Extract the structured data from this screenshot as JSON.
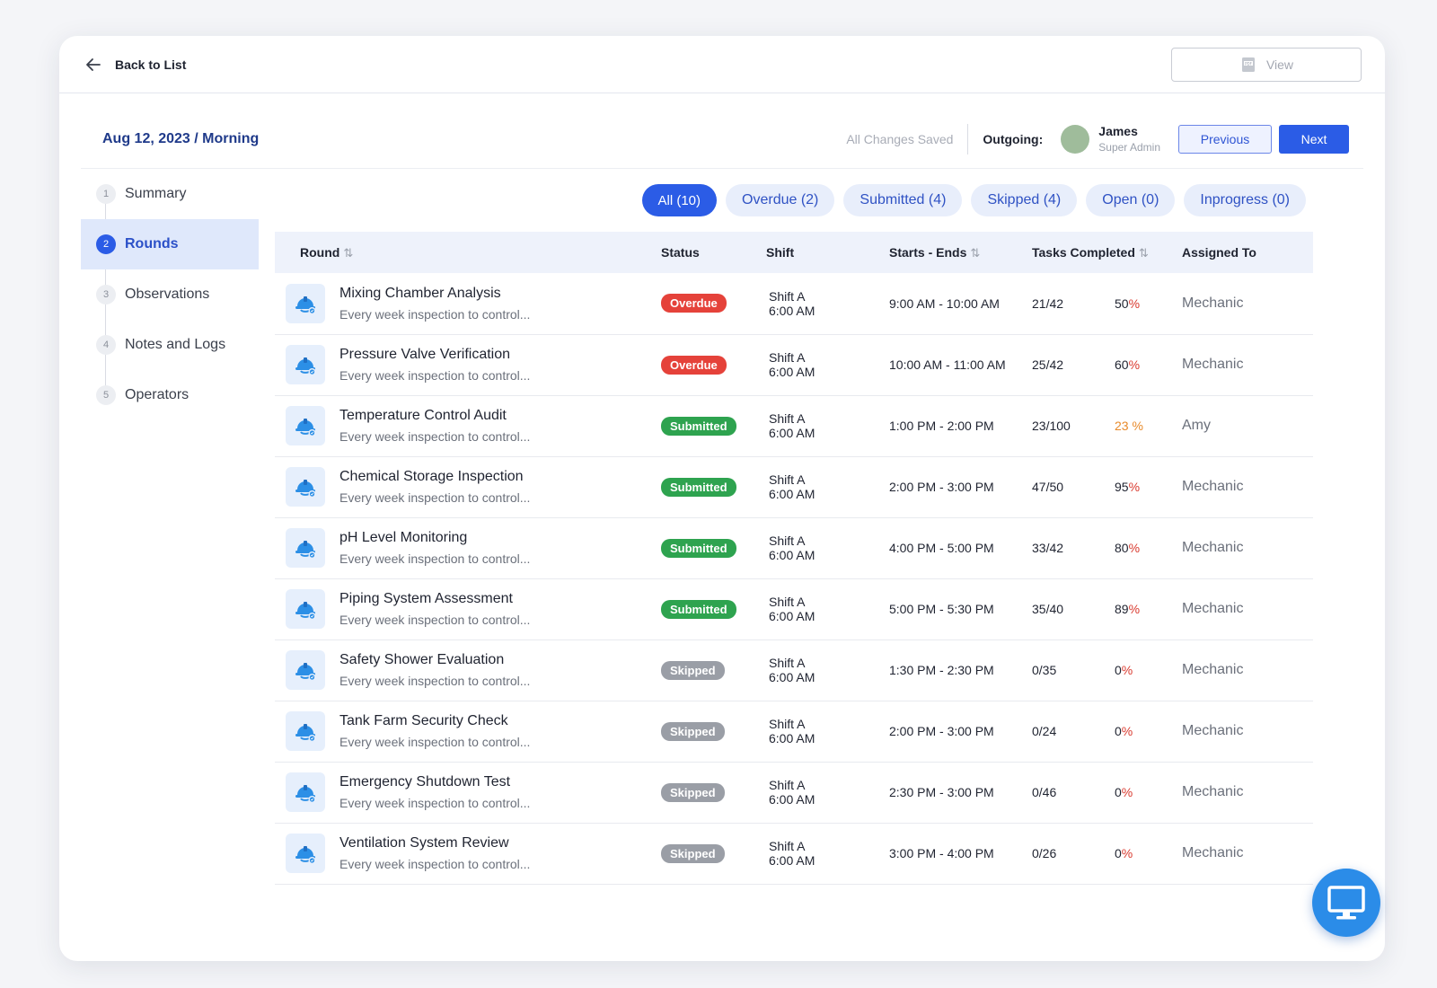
{
  "topbar": {
    "back_label": "Back to List",
    "view_label": "View"
  },
  "header": {
    "title": "Aug 12, 2023 / Morning",
    "save_status": "All Changes Saved",
    "outgoing_label": "Outgoing:",
    "user_name": "James",
    "user_role": "Super Admin",
    "prev_label": "Previous",
    "next_label": "Next"
  },
  "sidebar": {
    "steps": [
      {
        "num": "1",
        "label": "Summary"
      },
      {
        "num": "2",
        "label": "Rounds"
      },
      {
        "num": "3",
        "label": "Observations"
      },
      {
        "num": "4",
        "label": "Notes and Logs"
      },
      {
        "num": "5",
        "label": "Operators"
      }
    ],
    "active": "Rounds"
  },
  "filters": [
    "All (10)",
    "Overdue (2)",
    "Submitted (4)",
    "Skipped (4)",
    "Open (0)",
    "Inprogress (0)"
  ],
  "table": {
    "columns": [
      "Round",
      "Status",
      "Shift",
      "Starts - Ends",
      "Tasks Completed",
      "Assigned To"
    ],
    "rows": [
      {
        "name": "Mixing Chamber Analysis",
        "desc": "Every week inspection to control...",
        "status": "Overdue",
        "shift": "Shift A",
        "shift_time": "6:00 AM",
        "time": "9:00 AM - 10:00 AM",
        "tasks": "21/42",
        "pct": "50",
        "pct_sign": "%",
        "assigned": "Mechanic"
      },
      {
        "name": "Pressure Valve Verification",
        "desc": "Every week inspection to control...",
        "status": "Overdue",
        "shift": "Shift A",
        "shift_time": "6:00 AM",
        "time": "10:00 AM - 11:00 AM",
        "tasks": "25/42",
        "pct": "60",
        "pct_sign": "%",
        "assigned": "Mechanic"
      },
      {
        "name": "Temperature Control Audit",
        "desc": "Every week inspection to control...",
        "status": "Submitted",
        "shift": "Shift A",
        "shift_time": "6:00 AM",
        "time": "1:00 PM - 2:00 PM",
        "tasks": "23/100",
        "pct": "23",
        "pct_sign": " %",
        "assigned": "Amy"
      },
      {
        "name": "Chemical Storage Inspection",
        "desc": "Every week inspection to control...",
        "status": "Submitted",
        "shift": "Shift A",
        "shift_time": "6:00 AM",
        "time": "2:00 PM - 3:00 PM",
        "tasks": "47/50",
        "pct": "95",
        "pct_sign": "%",
        "assigned": "Mechanic"
      },
      {
        "name": "pH Level Monitoring",
        "desc": "Every week inspection to control...",
        "status": "Submitted",
        "shift": "Shift A",
        "shift_time": "6:00 AM",
        "time": "4:00 PM - 5:00 PM",
        "tasks": "33/42",
        "pct": "80",
        "pct_sign": "%",
        "assigned": "Mechanic"
      },
      {
        "name": "Piping System Assessment",
        "desc": "Every week inspection to control...",
        "status": "Submitted",
        "shift": "Shift A",
        "shift_time": "6:00 AM",
        "time": "5:00 PM - 5:30 PM",
        "tasks": "35/40",
        "pct": "89",
        "pct_sign": "%",
        "assigned": "Mechanic"
      },
      {
        "name": "Safety Shower Evaluation",
        "desc": "Every week inspection to control...",
        "status": "Skipped",
        "shift": "Shift A",
        "shift_time": "6:00 AM",
        "time": "1:30 PM - 2:30 PM",
        "tasks": "0/35",
        "pct": "0",
        "pct_sign": "%",
        "assigned": "Mechanic"
      },
      {
        "name": "Tank Farm Security Check",
        "desc": "Every week inspection to control...",
        "status": "Skipped",
        "shift": "Shift A",
        "shift_time": "6:00 AM",
        "time": "2:00 PM - 3:00 PM",
        "tasks": "0/24",
        "pct": "0",
        "pct_sign": "%",
        "assigned": "Mechanic"
      },
      {
        "name": "Emergency Shutdown Test",
        "desc": "Every week inspection to control...",
        "status": "Skipped",
        "shift": "Shift A",
        "shift_time": "6:00 AM",
        "time": "2:30 PM - 3:00 PM",
        "tasks": "0/46",
        "pct": "0",
        "pct_sign": "%",
        "assigned": "Mechanic"
      },
      {
        "name": "Ventilation System Review",
        "desc": "Every week inspection to control...",
        "status": "Skipped",
        "shift": "Shift A",
        "shift_time": "6:00 AM",
        "time": "3:00 PM - 4:00 PM",
        "tasks": "0/26",
        "pct": "0",
        "pct_sign": "%",
        "assigned": "Mechanic"
      }
    ]
  },
  "colors": {
    "primary": "#2b5ce6",
    "overdue": "#e5423a",
    "submitted": "#2ea34f",
    "skipped": "#9a9ea6",
    "pct_red": "#d93a2f",
    "pct_orange": "#e88a2a"
  },
  "icons": {
    "back": "arrow-left-icon",
    "view": "pdf-icon",
    "round": "hard-hat-icon",
    "sort": "sort-icon",
    "fab": "monitor-icon"
  }
}
